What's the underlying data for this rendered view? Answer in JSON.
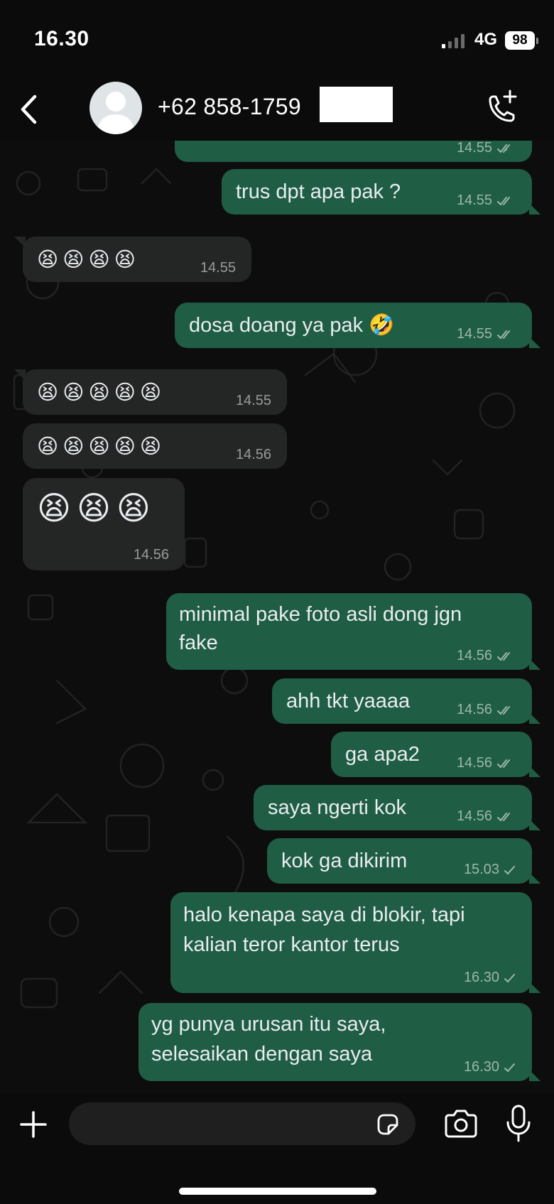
{
  "status_bar": {
    "time": "16.30",
    "network": "4G",
    "battery": "98"
  },
  "header": {
    "contact": "+62 858-1759",
    "back_icon": "chevron-left-icon",
    "avatar_icon": "default-avatar-icon",
    "call_icon": "add-call-icon"
  },
  "messages": [
    {
      "dir": "out",
      "text": "",
      "time": "14.55",
      "status": "read"
    },
    {
      "dir": "out",
      "text": "trus dpt apa pak ?",
      "time": "14.55",
      "status": "read"
    },
    {
      "dir": "in",
      "text": "😫😫😫😫",
      "time": "14.55"
    },
    {
      "dir": "out",
      "text": "dosa doang ya pak 🤣",
      "time": "14.55",
      "status": "read"
    },
    {
      "dir": "in",
      "text": "😫😫😫😫😫",
      "time": "14.55"
    },
    {
      "dir": "in",
      "text": "😫😫😫😫😫",
      "time": "14.56"
    },
    {
      "dir": "in",
      "text": "😫😫😫",
      "time": "14.56"
    },
    {
      "dir": "out",
      "text": [
        "minimal pake foto asli dong jgn",
        "fake"
      ],
      "time": "14.56",
      "status": "read"
    },
    {
      "dir": "out",
      "text": "ahh tkt yaaaa",
      "time": "14.56",
      "status": "read"
    },
    {
      "dir": "out",
      "text": "ga apa2",
      "time": "14.56",
      "status": "read"
    },
    {
      "dir": "out",
      "text": "saya ngerti kok",
      "time": "14.56",
      "status": "read"
    },
    {
      "dir": "out",
      "text": "kok ga dikirim",
      "time": "15.03",
      "status": "sent"
    },
    {
      "dir": "out",
      "text": [
        "halo kenapa saya di blokir, tapi",
        "kalian teror kantor terus"
      ],
      "time": "16.30",
      "status": "sent"
    },
    {
      "dir": "out",
      "text": [
        "yg punya urusan itu saya,",
        "selesaikan dengan saya"
      ],
      "time": "16.30",
      "status": "sent"
    }
  ],
  "composer": {
    "input_value": "",
    "plus_icon": "plus-icon",
    "sticker_icon": "sticker-icon",
    "camera_icon": "camera-icon",
    "mic_icon": "microphone-icon"
  },
  "colors": {
    "outgoing_bubble": "#1f5d45",
    "incoming_bubble": "#242626",
    "background": "#0d0d0d"
  }
}
